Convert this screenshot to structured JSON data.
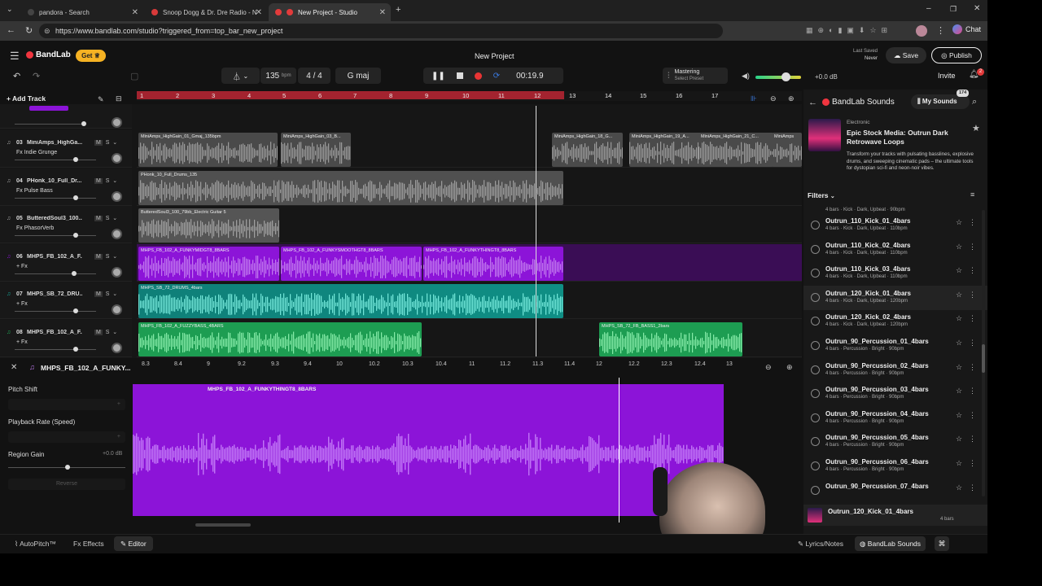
{
  "browser": {
    "tabs": [
      {
        "title": "pandora - Search",
        "active": false
      },
      {
        "title": "Snoop Dogg & Dr. Dre Radio - Now",
        "active": false
      },
      {
        "title": "New Project - Studio",
        "active": true
      }
    ],
    "url": "https://www.bandlab.com/studio?triggered_from=top_bar_new_project",
    "chat_label": "Chat"
  },
  "header": {
    "logo": "BandLab",
    "get_label": "Get",
    "title": "New Project",
    "last_saved_label": "Last Saved",
    "last_saved_value": "Never",
    "save_label": "Save",
    "publish_label": "Publish",
    "invite_label": "Invite",
    "notification_count": "2"
  },
  "toolbar": {
    "tempo": "135",
    "tempo_unit": "bpm",
    "time_sig": "4 / 4",
    "key": "G maj",
    "time": "00:19.9",
    "mastering_label": "Mastering",
    "mastering_sub": "Select Preset",
    "volume_db": "+0.0 dB",
    "add_track_label": "Add Track"
  },
  "ruler": {
    "bars": [
      "1",
      "2",
      "3",
      "4",
      "5",
      "6",
      "7",
      "8",
      "9",
      "10",
      "11",
      "12",
      "13",
      "14",
      "15",
      "16",
      "17"
    ]
  },
  "tracks": [
    {
      "num": "03",
      "name": "MiniAmps_HighGa...",
      "fx": "Fx Indie Grunge",
      "color": "#6b6b6b",
      "clips": [
        "MiniAmps_HighGain_01_Gmaj_135bpm",
        "MiniAmps_HighGain_03_B...",
        "MiniAmps_HighGain_18_G...",
        "MiniAmps_HighGain_19_A...",
        "MiniAmps_HighGain_21_C...",
        "MiniAmps"
      ]
    },
    {
      "num": "04",
      "name": "PHonk_10_Full_Dr...",
      "fx": "Fx Pulse Bass",
      "color": "#6b6b6b",
      "clips": [
        "PHonk_10_Full_Drums_135"
      ]
    },
    {
      "num": "05",
      "name": "ButteredSoul3_100...",
      "fx": "Fx PhasorVerb",
      "color": "#6b6b6b",
      "clips": [
        "ButteredSoul3_100_79bb_Electric Guitar 5"
      ]
    },
    {
      "num": "06",
      "name": "MHPS_FB_102_A_F...",
      "fx": "+ Fx",
      "color": "#8c14d8",
      "clips": [
        "MHPS_FB_102_A_FUNKYMIDGT8_8BARS",
        "MHPS_FB_102_A_FUNKYSMOOTHGT8_8BARS",
        "MHPS_FB_102_A_FUNKYTHINGT8_8BARS"
      ]
    },
    {
      "num": "07",
      "name": "MHPS_SB_72_DRU...",
      "fx": "+ Fx",
      "color": "#14a89a",
      "clips": [
        "MHPS_SB_72_DRUMS_4bars"
      ]
    },
    {
      "num": "08",
      "name": "MHPS_FB_102_A_F...",
      "fx": "+ Fx",
      "color": "#1fb35a",
      "clips": [
        "MHPS_FB_102_A_FUZZYBASS_4BARS",
        "MHPS_SB_72_FB_BASS1_2bars"
      ]
    }
  ],
  "editor": {
    "region_name": "MHPS_FB_102_A_FUNKY...",
    "clip_name": "MHPS_FB_102_A_FUNKYTHINGT8_8BARS",
    "ruler": [
      "8.3",
      "8.4",
      "9",
      "9.2",
      "9.3",
      "9.4",
      "10",
      "10.2",
      "10.3",
      "10.4",
      "11",
      "11.2",
      "11.3",
      "11.4",
      "12",
      "12.2",
      "12.3",
      "12.4",
      "13"
    ],
    "pitch_shift_label": "Pitch Shift",
    "playback_rate_label": "Playback Rate (Speed)",
    "region_gain_label": "Region Gain",
    "region_gain_value": "+0.0 dB",
    "reverse_label": "Reverse"
  },
  "sounds": {
    "title": "BandLab Sounds",
    "my_sounds_label": "My Sounds",
    "my_sounds_badge": "174",
    "pack_genre": "Electronic",
    "pack_title": "Epic Stock Media: Outrun Dark Retrowave Loops",
    "pack_desc": "Transform your tracks with pulsating basslines, explosive drums, and sweeping cinematic pads – the ultimate tools for dystopian sci-fi and neon-noir vibes.",
    "filters_label": "Filters",
    "partial_item_sub": "4 bars · Kick · Dark, Upbeat · 90bpm",
    "items": [
      {
        "title": "Outrun_110_Kick_01_4bars",
        "sub": "4 bars · Kick · Dark, Upbeat · 110bpm"
      },
      {
        "title": "Outrun_110_Kick_02_4bars",
        "sub": "4 bars · Kick · Dark, Upbeat · 110bpm"
      },
      {
        "title": "Outrun_110_Kick_03_4bars",
        "sub": "4 bars · Kick · Dark, Upbeat · 110bpm"
      },
      {
        "title": "Outrun_120_Kick_01_4bars",
        "sub": "4 bars · Kick · Dark, Upbeat · 120bpm"
      },
      {
        "title": "Outrun_120_Kick_02_4bars",
        "sub": "4 bars · Kick · Dark, Upbeat · 120bpm"
      },
      {
        "title": "Outrun_90_Percussion_01_4bars",
        "sub": "4 bars · Percussion · Bright · 90bpm"
      },
      {
        "title": "Outrun_90_Percussion_02_4bars",
        "sub": "4 bars · Percussion · Bright · 90bpm"
      },
      {
        "title": "Outrun_90_Percussion_03_4bars",
        "sub": "4 bars · Percussion · Bright · 90bpm"
      },
      {
        "title": "Outrun_90_Percussion_04_4bars",
        "sub": "4 bars · Percussion · Bright · 90bpm"
      },
      {
        "title": "Outrun_90_Percussion_05_4bars",
        "sub": "4 bars · Percussion · Bright · 90bpm"
      },
      {
        "title": "Outrun_90_Percussion_06_4bars",
        "sub": "4 bars · Percussion · Bright · 90bpm"
      },
      {
        "title": "Outrun_90_Percussion_07_4bars",
        "sub": ""
      }
    ],
    "playing_title": "Outrun_120_Kick_01_4bars",
    "playing_sub": "4 bars"
  },
  "bottom": {
    "autopitch_label": "AutoPitch™",
    "effects_label": "Effects",
    "editor_label": "Editor",
    "lyrics_label": "Lyrics/Notes",
    "sounds_label": "BandLab Sounds"
  },
  "colors": {
    "accent_red": "#a3232f",
    "purple": "#8c14d8",
    "teal": "#14a89a",
    "green": "#1fb35a",
    "publish": "#ffffff"
  }
}
